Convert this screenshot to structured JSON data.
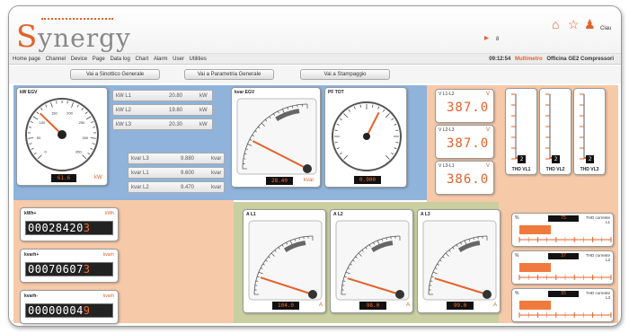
{
  "app": {
    "logo_initial": "S",
    "logo_rest": "ynergy",
    "notification_count": "8",
    "user_label": "Clau"
  },
  "menu": {
    "items": [
      "Home page",
      "Channel",
      "Device",
      "Page",
      "Data log",
      "Chart",
      "Alarm",
      "User",
      "Utilities"
    ],
    "time": "09:12:54",
    "device_type": "Multimetro",
    "plant": "Officina GE2 Compressori"
  },
  "nav_buttons": [
    "Vai a Sinottico Generale",
    "Vai a Parametria Generale",
    "Vai a Stampaggio"
  ],
  "kw": {
    "title": "kW EGV",
    "value": "61.6",
    "unit": "kW",
    "needle_fraction": 0.33,
    "ticks": [
      "0",
      "50",
      "100",
      "150",
      "200",
      "250",
      "300",
      "350"
    ]
  },
  "kw_rows": [
    {
      "label": "kW L1",
      "value": "20.80",
      "unit": "kW"
    },
    {
      "label": "kW L2",
      "value": "19.80",
      "unit": "kW"
    },
    {
      "label": "kW L3",
      "value": "20.30",
      "unit": "kW"
    }
  ],
  "kvar_rows": [
    {
      "label": "kvar L3",
      "value": "9.880",
      "unit": "kvar"
    },
    {
      "label": "kvar L1",
      "value": "9.600",
      "unit": "kvar"
    },
    {
      "label": "kvar L2",
      "value": "9.470",
      "unit": "kvar"
    }
  ],
  "kvar": {
    "title": "kvar EGV",
    "value": "28.40",
    "unit": "kvar",
    "needle_fraction": 0.3
  },
  "pf": {
    "title": "PF TOT",
    "value": "0.900",
    "needle_fraction": 0.1
  },
  "voltages": [
    {
      "label": "V L1-L2",
      "unit": "V",
      "value": "387.0"
    },
    {
      "label": "V L2-L3",
      "unit": "V",
      "value": "387.0"
    },
    {
      "label": "V L3-L1",
      "unit": "V",
      "value": "386.0"
    }
  ],
  "thd_v": [
    {
      "label": "THD VL1",
      "value": "2",
      "level": 0.03
    },
    {
      "label": "THD VL2",
      "value": "2",
      "level": 0.03
    },
    {
      "label": "THD VL3",
      "value": "2",
      "level": 0.03
    }
  ],
  "counters": [
    {
      "label": "kWh+",
      "unit": "kWh",
      "digits": "00028420",
      "last": "3"
    },
    {
      "label": "kvarh+",
      "unit": "kvarh",
      "digits": "00070607",
      "last": "3"
    },
    {
      "label": "kvarh-",
      "unit": "kvarh",
      "digits": "00000004",
      "last": "9"
    }
  ],
  "currents": [
    {
      "title": "A L1",
      "value": "104.0",
      "unit": "A",
      "needle_fraction": 0.2
    },
    {
      "title": "A L2",
      "value": "98.0",
      "unit": "A",
      "needle_fraction": 0.19
    },
    {
      "title": "A L3",
      "value": "99.0",
      "unit": "A",
      "needle_fraction": 0.19
    }
  ],
  "thd_a": [
    {
      "unit": "%",
      "label": "THD corrente L1",
      "value": "75",
      "level": 0.35
    },
    {
      "unit": "%",
      "label": "THD corrente L2",
      "value": "37",
      "level": 0.35
    },
    {
      "unit": "%",
      "label": "THD corrente L3",
      "value": "35",
      "level": 0.35
    }
  ],
  "colors": {
    "accent": "#e4612a",
    "blue_panel": "#8fb3da",
    "salmon_panel": "#f6c9a9",
    "green_panel": "#c9cfa0"
  }
}
